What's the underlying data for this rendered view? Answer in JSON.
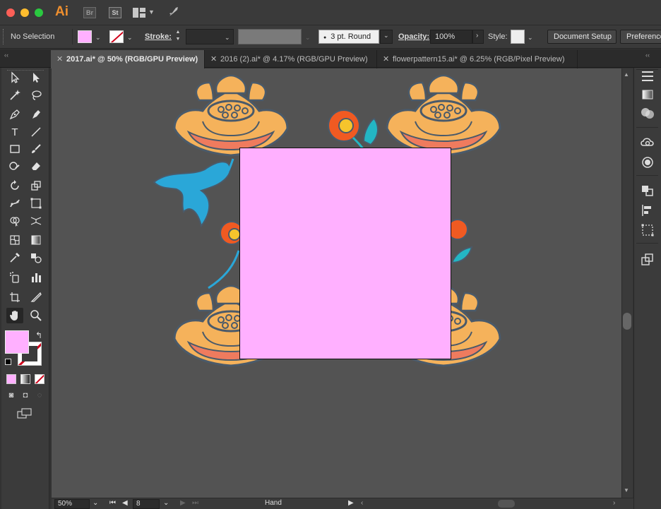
{
  "app": {
    "logo": "Ai",
    "bridge_label": "Br",
    "stock_label": "St"
  },
  "control": {
    "selection_label": "No Selection",
    "stroke_label": "Stroke:",
    "stroke_width_value": "",
    "brush_value": "3 pt. Round",
    "opacity_label": "Opacity:",
    "opacity_value": "100%",
    "style_label": "Style:",
    "document_setup_label": "Document Setup",
    "preferences_label": "Preferences",
    "fill_color": "#ffb0ff",
    "stroke_color": "none"
  },
  "tabs": [
    {
      "label": "2017.ai* @ 50% (RGB/GPU Preview)",
      "active": true
    },
    {
      "label": "2016 (2).ai* @ 4.17% (RGB/GPU Preview)",
      "active": false
    },
    {
      "label": "flowerpattern15.ai* @ 6.25% (RGB/Pixel Preview)",
      "active": false
    }
  ],
  "tools": [
    "selection-tool",
    "direct-selection-tool",
    "magic-wand-tool",
    "lasso-tool",
    "pen-tool",
    "curvature-tool",
    "type-tool",
    "line-segment-tool",
    "rectangle-tool",
    "paintbrush-tool",
    "shaper-tool",
    "eraser-tool",
    "rotate-tool",
    "scale-tool",
    "puppet-warp-tool",
    "free-transform-tool",
    "shape-builder-tool",
    "perspective-grid-tool",
    "mesh-tool",
    "gradient-tool",
    "eyedropper-tool",
    "blend-tool",
    "symbol-sprayer-tool",
    "column-graph-tool",
    "artboard-tool",
    "slice-tool",
    "hand-tool",
    "zoom-tool"
  ],
  "canvas": {
    "artwork_rect_color": "#ffb0ff",
    "canvas_bg": "#535353",
    "flower_orange": "#f5b25b",
    "flower_coral": "#ef7b5e",
    "flower_blue": "#2aa7d8",
    "flower_red": "#f05a22",
    "flower_yellow": "#f6c42c",
    "leaf_teal": "#23b6c4"
  },
  "status": {
    "zoom_value": "50%",
    "artboard_number": "8",
    "current_tool": "Hand"
  }
}
